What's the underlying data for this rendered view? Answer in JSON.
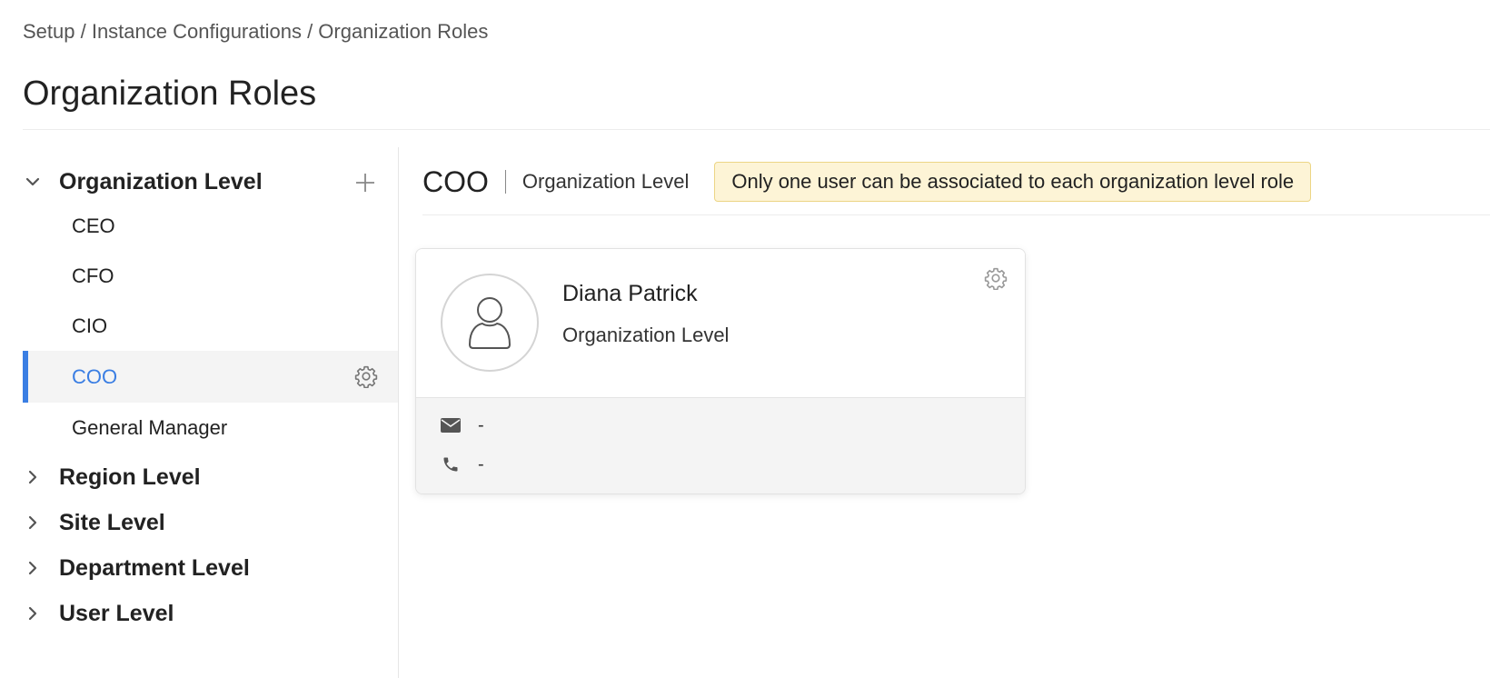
{
  "breadcrumb": "Setup / Instance Configurations / Organization Roles",
  "page_title": "Organization Roles",
  "sidebar": {
    "groups": [
      {
        "label": "Organization Level",
        "expanded": true
      },
      {
        "label": "Region Level",
        "expanded": false
      },
      {
        "label": "Site Level",
        "expanded": false
      },
      {
        "label": "Department Level",
        "expanded": false
      },
      {
        "label": "User Level",
        "expanded": false
      }
    ],
    "roles": [
      {
        "label": "CEO"
      },
      {
        "label": "CFO"
      },
      {
        "label": "CIO"
      },
      {
        "label": "COO",
        "active": true
      },
      {
        "label": "General Manager"
      }
    ]
  },
  "content": {
    "role_name": "COO",
    "role_level": "Organization Level",
    "banner": "Only one user can be associated to each organization level role"
  },
  "user_card": {
    "name": "Diana Patrick",
    "level": "Organization Level",
    "email": "-",
    "phone": "-"
  },
  "colors": {
    "accent": "#3a7ee3",
    "banner_bg": "#fdf4d6",
    "banner_border": "#ecd585"
  }
}
